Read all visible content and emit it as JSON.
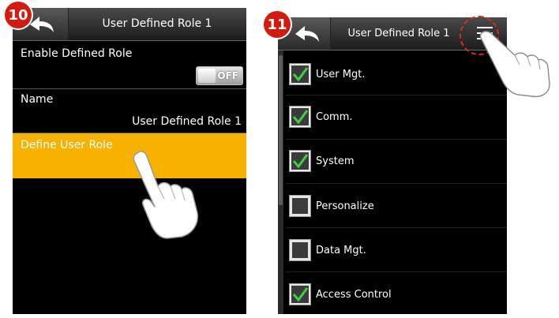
{
  "steps": {
    "first": "10",
    "second": "11"
  },
  "screen10": {
    "title": "User Defined Role 1",
    "enable_label": "Enable Defined Role",
    "toggle_text": "OFF",
    "name_label": "Name",
    "name_value": "User Defined Role 1",
    "define_label": "Define User Role"
  },
  "screen11": {
    "title": "User Defined Role 1",
    "items": [
      {
        "label": "User Mgt.",
        "checked": true
      },
      {
        "label": "Comm.",
        "checked": true
      },
      {
        "label": "System",
        "checked": true
      },
      {
        "label": "Personalize",
        "checked": false
      },
      {
        "label": "Data Mgt.",
        "checked": false
      },
      {
        "label": "Access Control",
        "checked": true
      }
    ]
  },
  "icons": {
    "back": "back-arrow-icon",
    "menu": "hamburger-menu-icon",
    "hand": "pointing-hand-icon",
    "check": "check-icon"
  },
  "colors": {
    "highlight": "#f7b200",
    "badge": "#d21a0e",
    "check": "#3dd13d"
  }
}
